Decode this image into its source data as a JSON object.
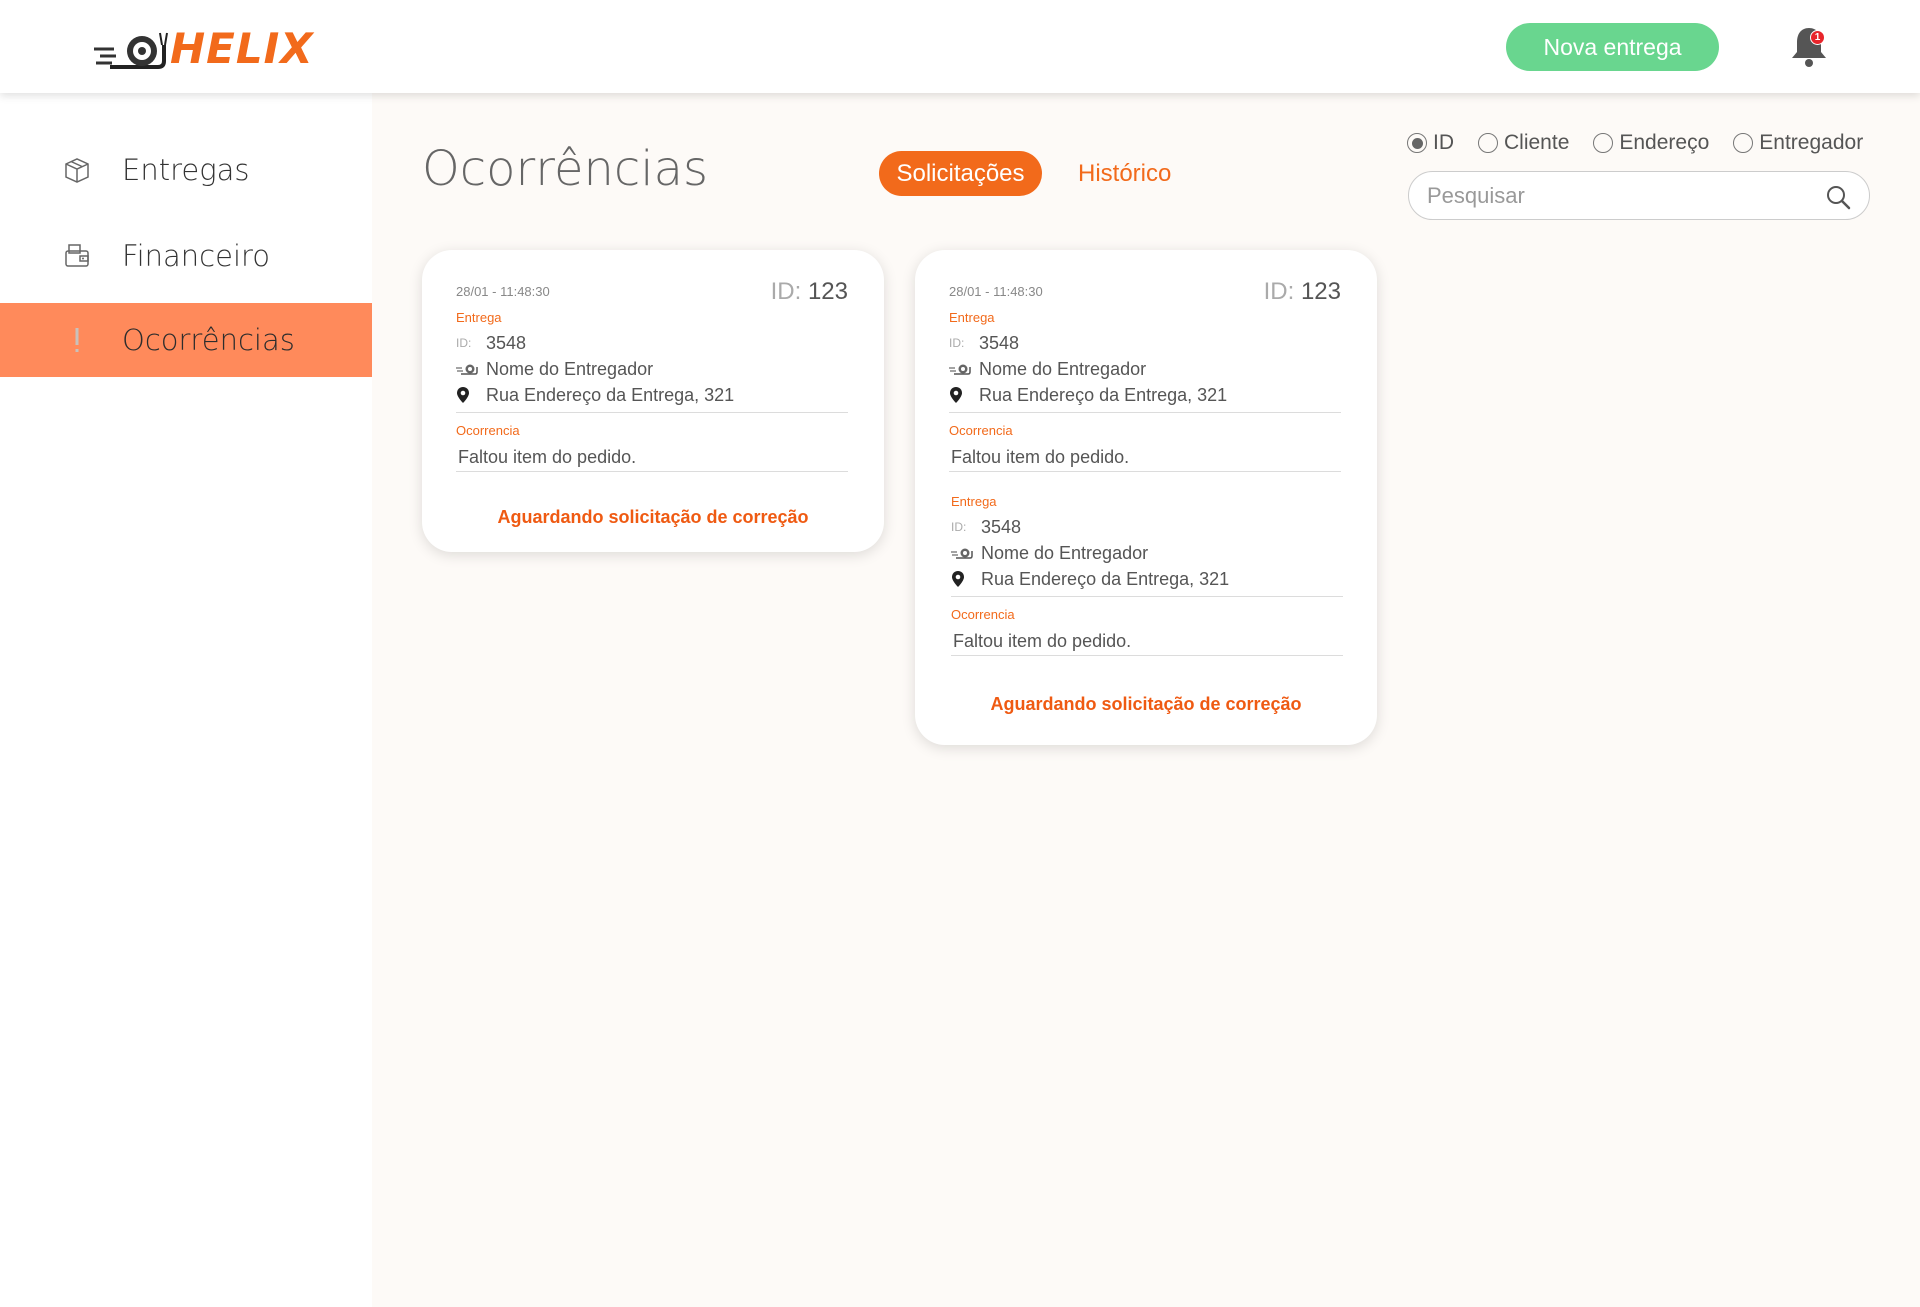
{
  "brand": {
    "name": "HELIX",
    "color": "#f26a1b"
  },
  "header": {
    "new_delivery_label": "Nova entrega",
    "notifications_count": "1"
  },
  "sidebar": {
    "items": [
      {
        "label": "Entregas",
        "icon": "box-icon",
        "active": false
      },
      {
        "label": "Financeiro",
        "icon": "wallet-icon",
        "active": false
      },
      {
        "label": "Ocorrências",
        "icon": "exclamation-icon",
        "active": true
      }
    ]
  },
  "main": {
    "title": "Ocorrências",
    "tabs": [
      {
        "label": "Solicitações",
        "active": true
      },
      {
        "label": "Histórico",
        "active": false
      }
    ],
    "filter": {
      "options": [
        {
          "label": "ID",
          "selected": true
        },
        {
          "label": "Cliente",
          "selected": false
        },
        {
          "label": "Endereço",
          "selected": false
        },
        {
          "label": "Entregador",
          "selected": false
        }
      ],
      "search_placeholder": "Pesquisar"
    }
  },
  "cards": [
    {
      "timestamp": "28/01 - 11:48:30",
      "id_key": "ID:",
      "id_value": "123",
      "entries": [
        {
          "delivery_label": "Entrega",
          "delivery_id_key": "ID:",
          "delivery_id": "3548",
          "courier": "Nome do Entregador",
          "address": "Rua Endereço da Entrega, 321",
          "occurrence_label": "Ocorrencia",
          "occurrence_text": "Faltou item do pedido."
        }
      ],
      "status": "Aguardando solicitação de correção"
    },
    {
      "timestamp": "28/01 - 11:48:30",
      "id_key": "ID:",
      "id_value": "123",
      "entries": [
        {
          "delivery_label": "Entrega",
          "delivery_id_key": "ID:",
          "delivery_id": "3548",
          "courier": "Nome do Entregador",
          "address": "Rua Endereço da Entrega, 321",
          "occurrence_label": "Ocorrencia",
          "occurrence_text": "Faltou item do pedido."
        },
        {
          "delivery_label": "Entrega",
          "delivery_id_key": "ID:",
          "delivery_id": "3548",
          "courier": "Nome do Entregador",
          "address": "Rua Endereço da Entrega, 321",
          "occurrence_label": "Ocorrencia",
          "occurrence_text": "Faltou item do pedido."
        }
      ],
      "status": "Aguardando solicitação de correção"
    }
  ],
  "colors": {
    "accent": "#f26a1b",
    "active_menu": "#ff8a5b",
    "new_button": "#69d68f",
    "badge": "#e8252b"
  }
}
